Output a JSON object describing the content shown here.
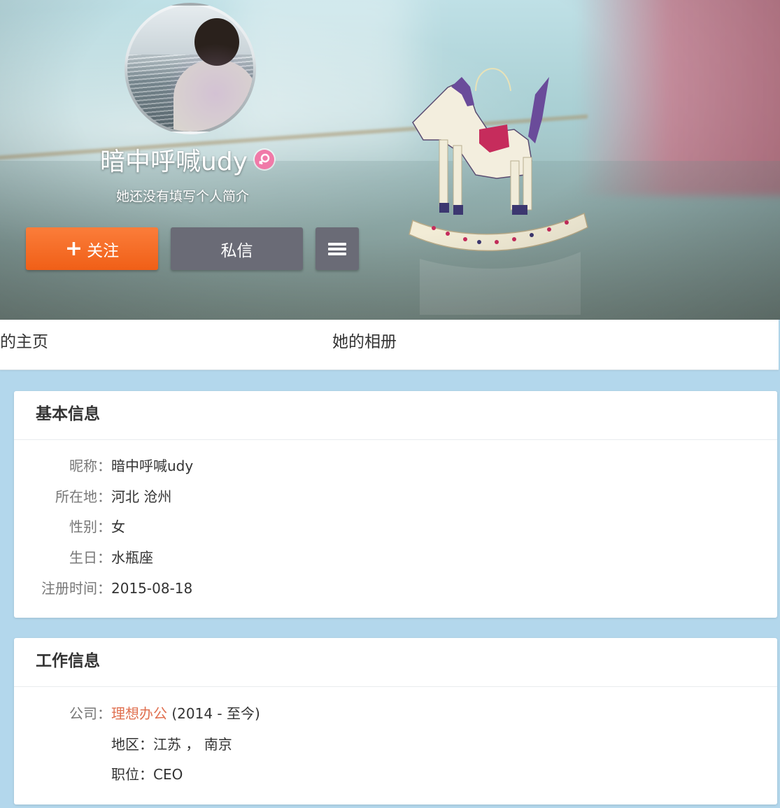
{
  "profile": {
    "name": "暗中呼喊udy",
    "bio": "她还没有填写个人简介",
    "gender_icon": "female-icon"
  },
  "actions": {
    "follow_label": "关注",
    "follow_icon": "plus-icon",
    "message_label": "私信",
    "more_icon": "menu-icon"
  },
  "tabs": {
    "home": "的主页",
    "album": "她的相册"
  },
  "basic_info": {
    "title": "基本信息",
    "rows": [
      {
        "label": "昵称：",
        "value": "暗中呼喊udy"
      },
      {
        "label": "所在地：",
        "value": "河北 沧州"
      },
      {
        "label": "性别：",
        "value": "女"
      },
      {
        "label": "生日：",
        "value": "水瓶座"
      },
      {
        "label": "注册时间：",
        "value": "2015-08-18"
      }
    ]
  },
  "work_info": {
    "title": "工作信息",
    "company_label": "公司：",
    "company_name": "理想办公",
    "company_period": "(2014 - 至今)",
    "region": "地区：江苏 ， 南京",
    "position": "职位：CEO"
  },
  "colors": {
    "follow": "#f05f17",
    "secondary_button": "#6a6b76",
    "link": "#e07050",
    "page_bg": "#b3d7ec"
  }
}
